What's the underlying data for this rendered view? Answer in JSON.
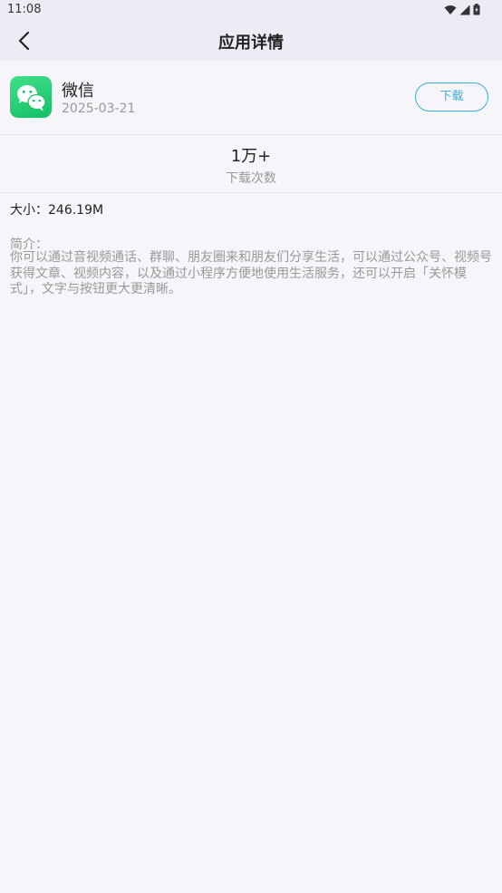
{
  "status_bar": {
    "time": "11:08",
    "icons": [
      "wifi-icon",
      "signal-icon",
      "battery-charging-icon"
    ]
  },
  "app_bar": {
    "title": "应用详情",
    "back_icon": "chevron-left-icon"
  },
  "app": {
    "name": "微信",
    "date": "2025-03-21",
    "icon": "wechat-icon",
    "icon_color": "#22c96f",
    "download_label": "下载",
    "accent_color": "#3aaed8"
  },
  "stats": {
    "downloads_value": "1万+",
    "downloads_label": "下载次数"
  },
  "details": {
    "size": "大小：246.19M",
    "intro_label": "简介：",
    "intro_text": "你可以通过音视频通话、群聊、朋友圈来和朋友们分享生活，可以通过公众号、视频号获得文章、视频内容，以及通过小程序方便地使用生活服务，还可以开启「关怀模式」，文字与按钮更大更清晰。"
  }
}
